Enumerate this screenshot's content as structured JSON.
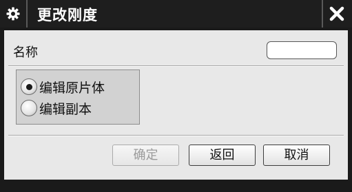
{
  "window": {
    "title": "更改刚度",
    "settings_icon": "gear-icon",
    "close_icon": "close-icon"
  },
  "form": {
    "name_label": "名称",
    "name_value": "",
    "options": [
      {
        "label": "编辑原片体",
        "selected": true
      },
      {
        "label": "编辑副本",
        "selected": false
      }
    ]
  },
  "buttons": {
    "ok_label": "确定",
    "ok_enabled": false,
    "back_label": "返回",
    "cancel_label": "取消"
  },
  "colors": {
    "titlebar": "#1e1e1e",
    "dialog_bg": "#e8e8e8",
    "group_bg": "#d2d2d2",
    "disabled_text": "#9a9a9a"
  }
}
